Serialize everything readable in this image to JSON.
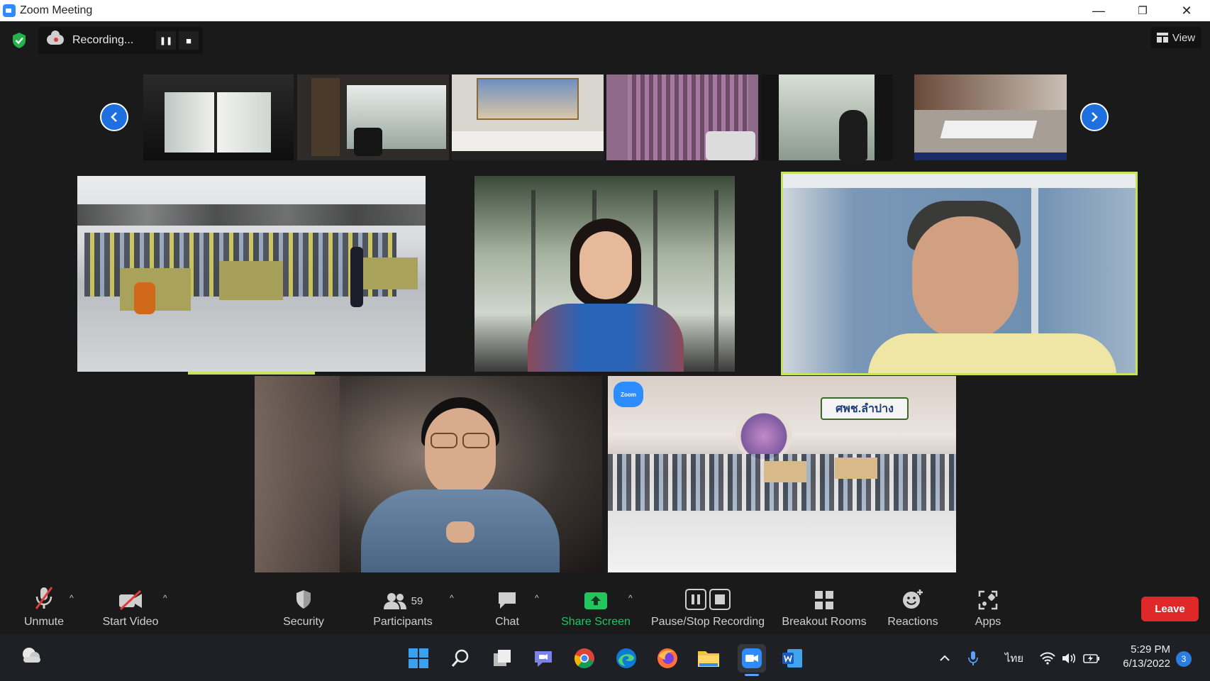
{
  "window": {
    "title": "Zoom Meeting",
    "minimize": "—",
    "restore": "❐",
    "close": "✕"
  },
  "recording": {
    "status": "Recording...",
    "pause": "❚❚",
    "stop": "■"
  },
  "view": {
    "label": "View"
  },
  "toolbar": {
    "unmute": "Unmute",
    "start_video": "Start Video",
    "security": "Security",
    "participants": "Participants",
    "participants_count": "59",
    "chat": "Chat",
    "share_screen": "Share Screen",
    "pause_stop_recording": "Pause/Stop Recording",
    "breakout_rooms": "Breakout Rooms",
    "reactions": "Reactions",
    "apps": "Apps",
    "leave": "Leave",
    "caret": "^"
  },
  "tiles": {
    "banner_text": "ศพช.ลำปาง",
    "zoom_badge": "Zoom"
  },
  "taskbar": {
    "language": "ไทย",
    "time": "5:29 PM",
    "date": "6/13/2022",
    "notifications": "3"
  },
  "colors": {
    "accent": "#2d8cff",
    "share_green": "#22c55e",
    "leave_red": "#e02828",
    "speaker_outline": "#c8e25a"
  }
}
